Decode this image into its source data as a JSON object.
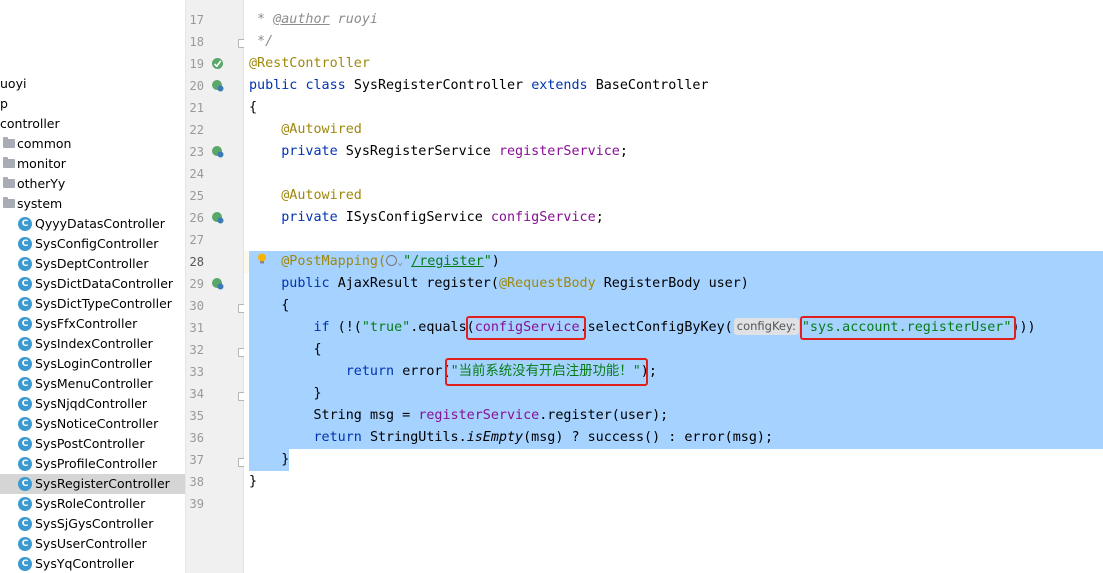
{
  "project_tree": {
    "items": [
      {
        "label": "uoyi",
        "kind": "text",
        "indent": 0
      },
      {
        "label": "p",
        "kind": "text",
        "indent": 0
      },
      {
        "label": "controller",
        "kind": "text",
        "indent": 0
      },
      {
        "label": "common",
        "kind": "folder",
        "indent": 1
      },
      {
        "label": "monitor",
        "kind": "folder",
        "indent": 1
      },
      {
        "label": "otherYy",
        "kind": "folder",
        "indent": 1
      },
      {
        "label": "system",
        "kind": "folder",
        "indent": 1
      },
      {
        "label": "QyyyDatasController",
        "kind": "class",
        "indent": 2
      },
      {
        "label": "SysConfigController",
        "kind": "class",
        "indent": 2
      },
      {
        "label": "SysDeptController",
        "kind": "class",
        "indent": 2
      },
      {
        "label": "SysDictDataController",
        "kind": "class",
        "indent": 2
      },
      {
        "label": "SysDictTypeController",
        "kind": "class",
        "indent": 2
      },
      {
        "label": "SysFfxController",
        "kind": "class",
        "indent": 2
      },
      {
        "label": "SysIndexController",
        "kind": "class",
        "indent": 2
      },
      {
        "label": "SysLoginController",
        "kind": "class",
        "indent": 2
      },
      {
        "label": "SysMenuController",
        "kind": "class",
        "indent": 2
      },
      {
        "label": "SysNjqdController",
        "kind": "class",
        "indent": 2
      },
      {
        "label": "SysNoticeController",
        "kind": "class",
        "indent": 2
      },
      {
        "label": "SysPostController",
        "kind": "class",
        "indent": 2
      },
      {
        "label": "SysProfileController",
        "kind": "class",
        "indent": 2
      },
      {
        "label": "SysRegisterController",
        "kind": "class",
        "indent": 2,
        "selected": true
      },
      {
        "label": "SysRoleController",
        "kind": "class",
        "indent": 2
      },
      {
        "label": "SysSjGysController",
        "kind": "class",
        "indent": 2
      },
      {
        "label": "SysUserController",
        "kind": "class",
        "indent": 2
      },
      {
        "label": "SysYqController",
        "kind": "class",
        "indent": 2
      }
    ],
    "class_icon_letter": "C"
  },
  "editor": {
    "current_line": "28",
    "line_numbers": [
      "17",
      "18",
      "19",
      "20",
      "21",
      "22",
      "23",
      "24",
      "25",
      "26",
      "27",
      "28",
      "29",
      "30",
      "31",
      "32",
      "33",
      "34",
      "35",
      "36",
      "37",
      "38",
      "39"
    ],
    "tokens": {
      "doc_star": " * ",
      "doc_author": "@author",
      "doc_author_value": " ruoyi",
      "doc_end": " */",
      "ann_rest_controller": "@RestController",
      "kw_public": "public",
      "kw_class": "class",
      "class_name": "SysRegisterController",
      "kw_extends": "extends",
      "base_class": "BaseController",
      "brace_open": "{",
      "brace_close": "}",
      "ann_autowired": "@Autowired",
      "kw_private": "private",
      "type_register_service": "SysRegisterService",
      "field_register_service": "registerService",
      "semicolon": ";",
      "type_config_service": "ISysConfigService",
      "field_config_service": "configService",
      "ann_post_mapping": "@PostMapping(",
      "path_quote": "\"",
      "path_register": "/register",
      "paren_close": ")",
      "type_ajax_result": "AjaxResult",
      "method_register": "register(",
      "ann_request_body": "@RequestBody",
      "type_register_body": "RegisterBody",
      "param_user": "user)",
      "kw_if": "if",
      "if_open": " (!(",
      "str_true": "\"true\"",
      "call_equals": ".equals(",
      "call_select": ".selectConfigByKey(",
      "hint_config_key": "configKey:",
      "str_config_key": "\"sys.account.registerUser\"",
      "parens_close_if": ")))",
      "kw_return": "return",
      "call_error": "error(",
      "str_error_msg": "\"当前系统没有开启注册功能！\"",
      "type_string": "String",
      "var_msg_assign": "msg = ",
      "call_register": ".register(user);",
      "string_utils": "StringUtils.",
      "is_empty": "isEmpty",
      "ternary_rest": "(msg) ? success() : error(msg);"
    }
  },
  "colors": {
    "keyword": "#0033b3",
    "annotation": "#9e880d",
    "field": "#871094",
    "string": "#067d17",
    "comment": "#8c8c8c",
    "selection": "#a6d2ff",
    "highlight_box": "#e0201c",
    "class_icon": "#3d9ad1"
  }
}
